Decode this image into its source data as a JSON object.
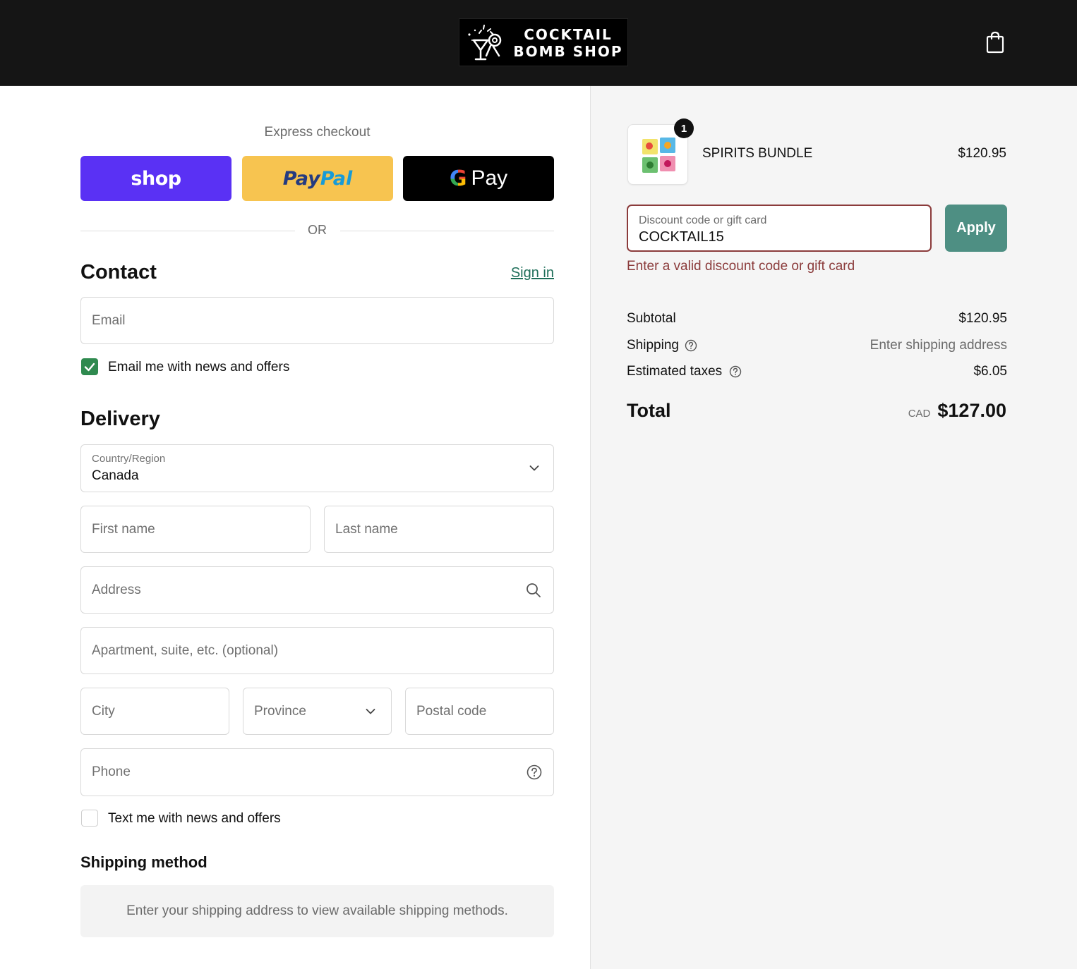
{
  "header": {
    "logo_line1": "COCKTAIL",
    "logo_line2": "BOMB SHOP"
  },
  "express": {
    "label": "Express checkout",
    "shop_label": "shop",
    "paypal_label_a": "Pay",
    "paypal_label_b": "Pal",
    "gpay_g": "G",
    "gpay_label": "Pay",
    "or_label": "OR"
  },
  "contact": {
    "title": "Contact",
    "signin": "Sign in",
    "email_placeholder": "Email",
    "newsletter_label": "Email me with news and offers",
    "newsletter_checked": true
  },
  "delivery": {
    "title": "Delivery",
    "country_label": "Country/Region",
    "country_value": "Canada",
    "first_name_placeholder": "First name",
    "last_name_placeholder": "Last name",
    "address_placeholder": "Address",
    "apartment_placeholder": "Apartment, suite, etc. (optional)",
    "city_placeholder": "City",
    "province_placeholder": "Province",
    "postal_placeholder": "Postal code",
    "phone_placeholder": "Phone",
    "sms_label": "Text me with news and offers",
    "sms_checked": false
  },
  "shipping_method": {
    "title": "Shipping method",
    "message": "Enter your shipping address to view available shipping methods."
  },
  "summary": {
    "item": {
      "quantity": "1",
      "name": "SPIRITS BUNDLE",
      "price": "$120.95"
    },
    "discount": {
      "label": "Discount code or gift card",
      "value": "COCKTAIL15",
      "apply_label": "Apply",
      "error": "Enter a valid discount code or gift card"
    },
    "subtotal_label": "Subtotal",
    "subtotal_value": "$120.95",
    "shipping_label": "Shipping",
    "shipping_value": "Enter shipping address",
    "taxes_label": "Estimated taxes",
    "taxes_value": "$6.05",
    "total_label": "Total",
    "total_currency": "CAD",
    "total_value": "$127.00"
  },
  "colors": {
    "shop_pay": "#5a31f4",
    "paypal": "#f7c450",
    "accent": "#4e8f83",
    "error": "#8b3b3b",
    "checkbox_on": "#2f8a4f"
  },
  "icons": {
    "cart": "shopping-bag-icon",
    "chevron": "chevron-down-icon",
    "search": "search-icon",
    "help": "question-circle-icon",
    "check": "check-icon"
  }
}
